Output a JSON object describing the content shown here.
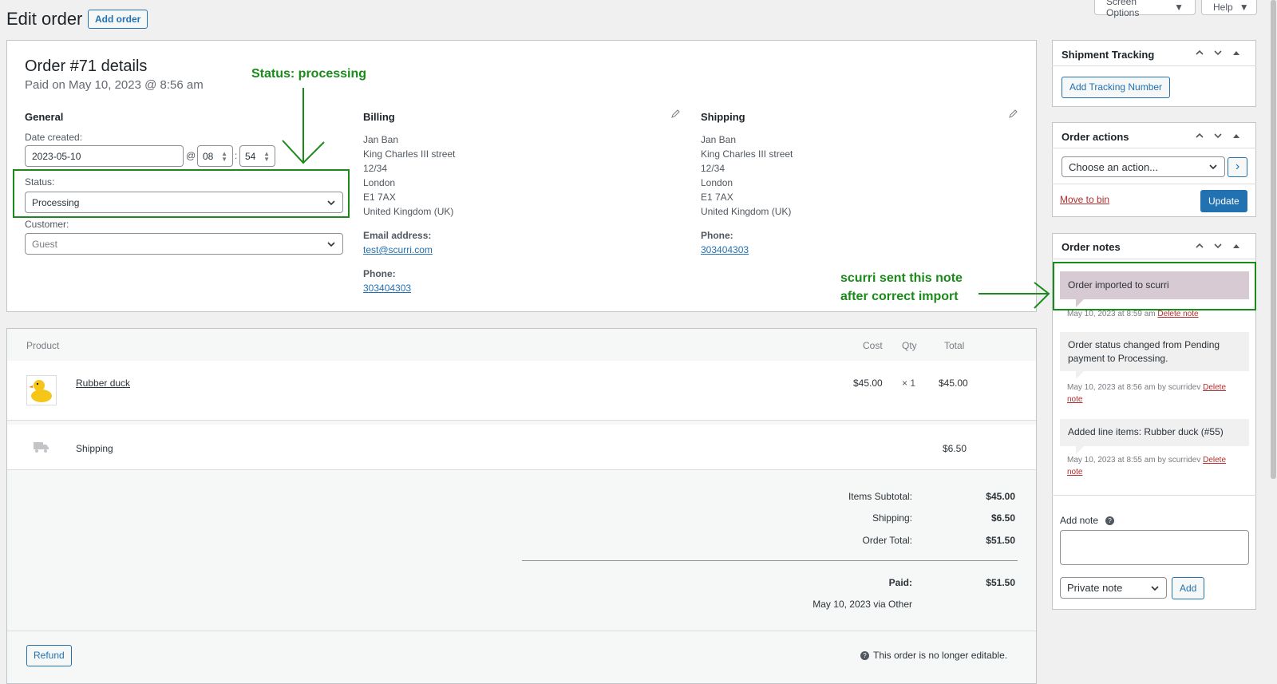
{
  "header": {
    "title": "Edit order",
    "add_order": "Add order",
    "screen_options": "Screen Options",
    "help": "Help"
  },
  "order": {
    "title": "Order #71 details",
    "paid_line": "Paid on May 10, 2023 @ 8:56 am",
    "general": {
      "heading": "General",
      "date_label": "Date created:",
      "date_value": "2023-05-10",
      "at": "@",
      "hour": "08",
      "colon": ":",
      "minute": "54",
      "status_label": "Status:",
      "status_value": "Processing",
      "customer_label": "Customer:",
      "customer_value": "Guest"
    },
    "billing": {
      "heading": "Billing",
      "lines": [
        "Jan Ban",
        "King Charles III street",
        "12/34",
        "London",
        "E1 7AX",
        "United Kingdom (UK)"
      ],
      "email_label": "Email address:",
      "email": "test@scurri.com",
      "phone_label": "Phone:",
      "phone": "303404303"
    },
    "shipping": {
      "heading": "Shipping",
      "lines": [
        "Jan Ban",
        "King Charles III street",
        "12/34",
        "London",
        "E1 7AX",
        "United Kingdom (UK)"
      ],
      "phone_label": "Phone:",
      "phone": "303404303"
    }
  },
  "annotations": {
    "status": "Status: processing",
    "note_line1": "scurri sent this note",
    "note_line2": "after correct import"
  },
  "items": {
    "head": {
      "product": "Product",
      "cost": "Cost",
      "qty": "Qty",
      "total": "Total"
    },
    "line": {
      "name": "Rubber duck",
      "cost": "$45.00",
      "qty": "× 1",
      "total": "$45.00"
    },
    "shipping": {
      "name": "Shipping",
      "total": "$6.50"
    },
    "totals": {
      "subtotal_label": "Items Subtotal:",
      "subtotal": "$45.00",
      "shipping_label": "Shipping:",
      "shipping": "$6.50",
      "total_label": "Order Total:",
      "total": "$51.50",
      "paid_label": "Paid:",
      "paid": "$51.50",
      "paid_via": "May 10, 2023 via Other"
    },
    "refund": "Refund",
    "not_editable": "This order is no longer editable."
  },
  "sidebar": {
    "tracking": {
      "title": "Shipment Tracking",
      "button": "Add Tracking Number"
    },
    "actions": {
      "title": "Order actions",
      "select": "Choose an action...",
      "go": "›",
      "trash": "Move to bin",
      "update": "Update"
    },
    "notes": {
      "title": "Order notes",
      "items": [
        {
          "text": "Order imported to scurri",
          "date": "May 10, 2023 at 8:59 am",
          "by": "",
          "delete": "Delete note"
        },
        {
          "text": "Order status changed from Pending payment to Processing.",
          "date": "May 10, 2023 at 8:56 am",
          "by": "by scurridev",
          "delete": "Delete",
          "delete2": "note"
        },
        {
          "text": "Added line items: Rubber duck (#55)",
          "date": "May 10, 2023 at 8:55 am",
          "by": "by scurridev",
          "delete": "Delete",
          "delete2": "note"
        }
      ],
      "add_label": "Add note",
      "help_icon": "?",
      "type": "Private note",
      "add_button": "Add"
    }
  },
  "colors": {
    "accent": "#2271b1",
    "annotation": "#1a8a1a",
    "system_note": "#d7cad2"
  }
}
